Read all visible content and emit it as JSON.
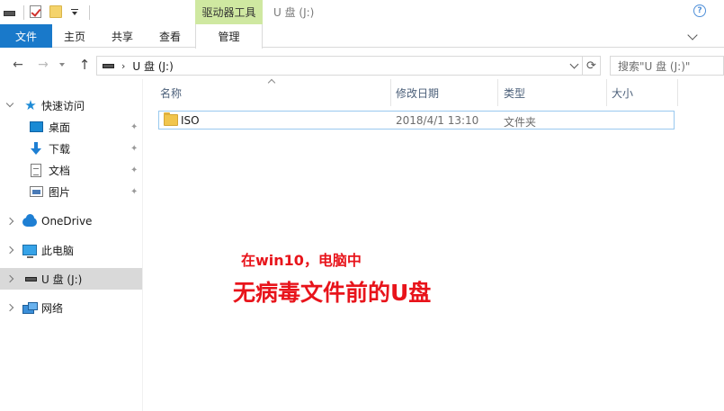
{
  "titlebar": {
    "context_tab": "驱动器工具",
    "window_title": "U 盘 (J:)"
  },
  "ribbon": {
    "file": "文件",
    "home": "主页",
    "share": "共享",
    "view": "查看",
    "manage": "管理"
  },
  "address": {
    "crumb": "U 盘 (J:)",
    "search_placeholder": "搜索\"U 盘 (J:)\""
  },
  "nav": {
    "quick_access": "快速访问",
    "desktop": "桌面",
    "downloads": "下载",
    "documents": "文档",
    "pictures": "图片",
    "onedrive": "OneDrive",
    "this_pc": "此电脑",
    "usb": "U 盘 (J:)",
    "network": "网络"
  },
  "columns": {
    "name": "名称",
    "date": "修改日期",
    "type": "类型",
    "size": "大小"
  },
  "files": [
    {
      "name": "ISO",
      "date": "2018/4/1 13:10",
      "type": "文件夹"
    }
  ],
  "annotation": {
    "line1": "在win10，电脑中",
    "line2": "无病毒文件前的U盘"
  }
}
